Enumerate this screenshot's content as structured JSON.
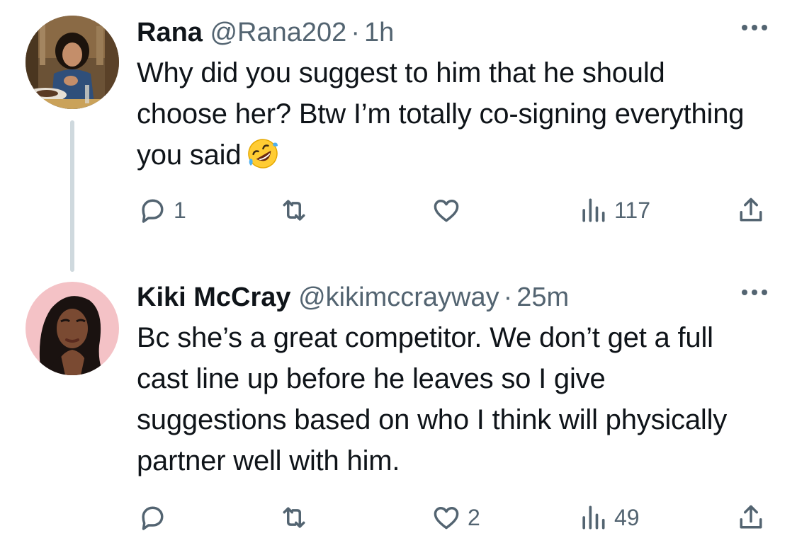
{
  "tweets": [
    {
      "display_name": "Rana",
      "handle": "@Rana202",
      "separator": "·",
      "time": "1h",
      "text": "Why did you suggest to him that he should choose her? Btw I’m totally co-signing everything you said",
      "emoji": "rolling-on-floor-laughing",
      "replies": "1",
      "retweets": "",
      "likes": "",
      "views": "117"
    },
    {
      "display_name": "Kiki McCray",
      "handle": "@kikimccrayway",
      "separator": "·",
      "time": "25m",
      "text": "Bc she’s a great competitor. We don’t get a full cast line up before he leaves so I give suggestions based on who I think will physically partner well with him.",
      "replies": "",
      "retweets": "",
      "likes": "2",
      "views": "49"
    }
  ],
  "colors": {
    "text": "#0f1419",
    "muted": "#536471",
    "thread_line": "#cfd9de",
    "kiki_avatar_bg": "#f4c2c6"
  }
}
